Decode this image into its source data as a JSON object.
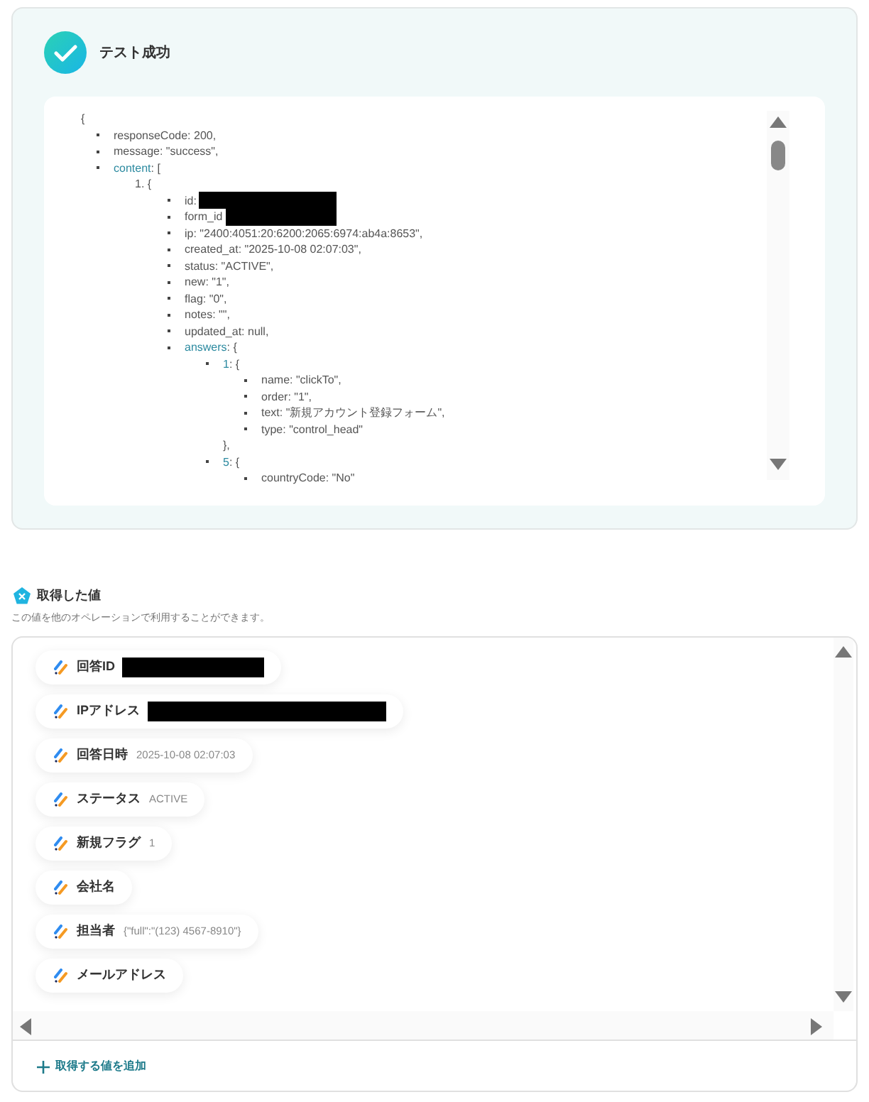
{
  "result": {
    "title": "テスト成功",
    "code": {
      "open": "{",
      "items": [
        {
          "key": "responseCode",
          "value": ": 200,"
        },
        {
          "key": "message",
          "value": ": \"success\","
        },
        {
          "key": "content",
          "value": ": [",
          "linked": true,
          "children": [
            {
              "marker": "1.",
              "value": " {",
              "children": [
                {
                  "key": "id",
                  "value": ":",
                  "redacted": true
                },
                {
                  "key": "form_id",
                  "redacted": true
                },
                {
                  "key": "ip",
                  "value": ": \"2400:4051:20:6200:2065:6974:ab4a:8653\","
                },
                {
                  "key": "created_at",
                  "value": ": \"2025-10-08 02:07:03\","
                },
                {
                  "key": "status",
                  "value": ": \"ACTIVE\","
                },
                {
                  "key": "new",
                  "value": ": \"1\","
                },
                {
                  "key": "flag",
                  "value": ": \"0\","
                },
                {
                  "key": "notes",
                  "value": ": \"\","
                },
                {
                  "key": "updated_at",
                  "value": ": null,"
                },
                {
                  "key": "answers",
                  "value": ": {",
                  "linked": true,
                  "children": [
                    {
                      "key": "1",
                      "value": ": {",
                      "linked": true,
                      "close": "},",
                      "children": [
                        {
                          "key": "name",
                          "value": ": \"clickTo\","
                        },
                        {
                          "key": "order",
                          "value": ": \"1\","
                        },
                        {
                          "key": "text",
                          "value": ": \"新規アカウント登録フォーム\","
                        },
                        {
                          "key": "type",
                          "value": ": \"control_head\""
                        }
                      ]
                    },
                    {
                      "key": "5",
                      "value": ": {",
                      "linked": true,
                      "children": [
                        {
                          "key": "countryCode",
                          "value": ": \"No\""
                        }
                      ]
                    }
                  ]
                }
              ]
            }
          ]
        }
      ]
    }
  },
  "values": {
    "title": "取得した値",
    "subtitle": "この値を他のオペレーションで利用することができます。",
    "items": [
      {
        "kind": "redacted",
        "label": "回答ID"
      },
      {
        "kind": "redacted_wide",
        "label": "IPアドレス"
      },
      {
        "kind": "text",
        "label": "回答日時",
        "value": "2025-10-08 02:07:03"
      },
      {
        "kind": "text",
        "label": "ステータス",
        "value": "ACTIVE"
      },
      {
        "kind": "text",
        "label": "新規フラグ",
        "value": "1"
      },
      {
        "kind": "text",
        "label": "会社名"
      },
      {
        "kind": "text",
        "label": "担当者",
        "value": "{\"full\":\"(123) 4567-8910\"}"
      },
      {
        "kind": "text",
        "label": "メールアドレス"
      }
    ],
    "add_button": "取得する値を追加"
  }
}
